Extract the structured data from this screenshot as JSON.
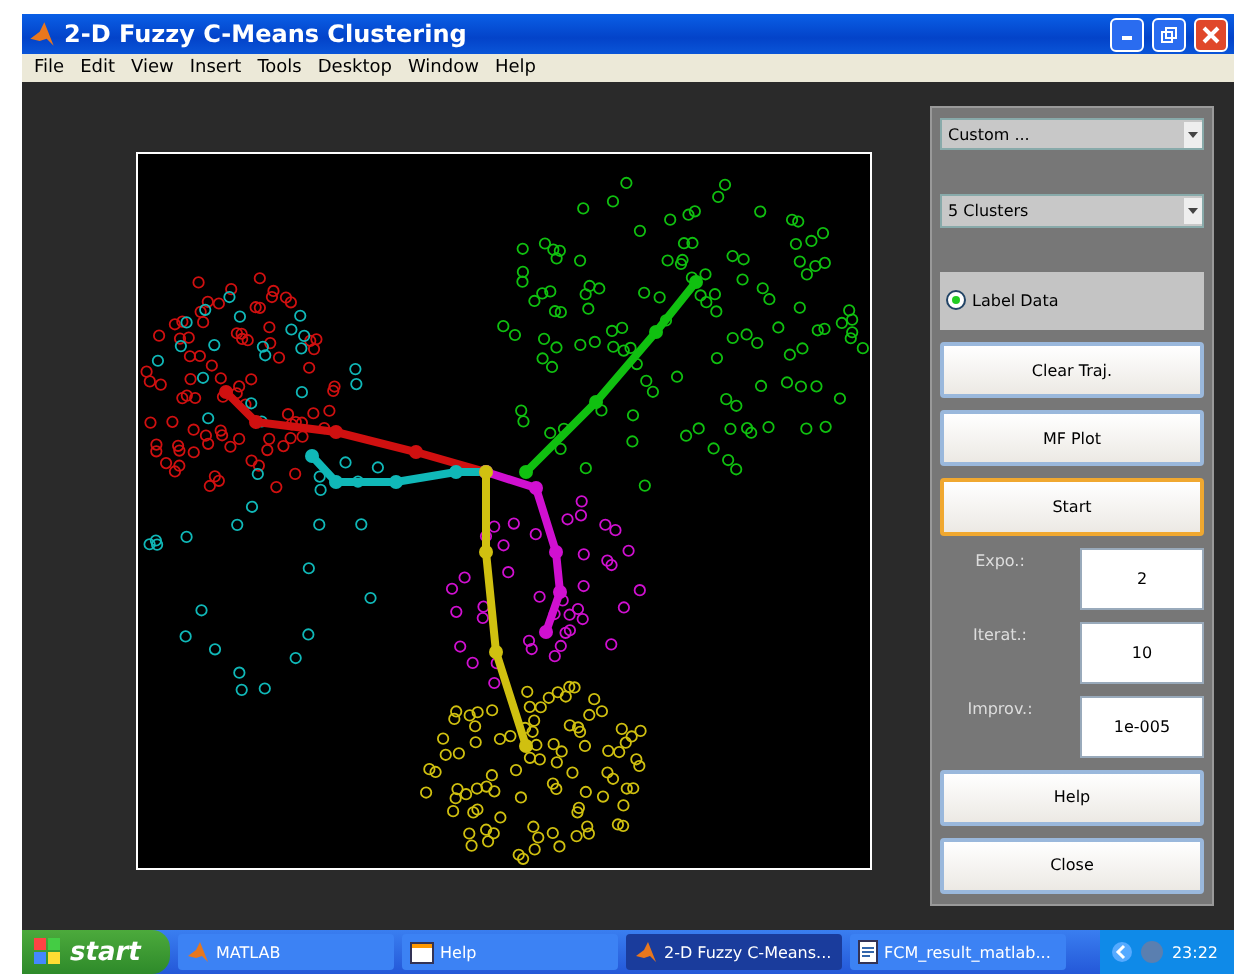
{
  "window": {
    "title": "2-D Fuzzy C-Means Clustering"
  },
  "menu": [
    "File",
    "Edit",
    "View",
    "Insert",
    "Tools",
    "Desktop",
    "Window",
    "Help"
  ],
  "panel": {
    "dropdowns": [
      {
        "value": "Custom ..."
      },
      {
        "value": "5 Clusters"
      }
    ],
    "radio": {
      "label": "Label Data",
      "checked": true
    },
    "buttons_top": [
      {
        "label": "Clear Traj.",
        "focused": false
      },
      {
        "label": "MF Plot",
        "focused": false
      },
      {
        "label": "Start",
        "focused": true
      }
    ],
    "params": [
      {
        "label": "Expo.:",
        "value": "2"
      },
      {
        "label": "Iterat.:",
        "value": "10"
      },
      {
        "label": "Improv.:",
        "value": "1e-005"
      }
    ],
    "buttons_bottom": [
      {
        "label": "Help",
        "focused": false
      },
      {
        "label": "Close",
        "focused": false
      }
    ]
  },
  "taskbar": {
    "start": "start",
    "items": [
      {
        "label": "MATLAB",
        "selected": false,
        "kind": "matlab"
      },
      {
        "label": "Help",
        "selected": false,
        "kind": "help"
      },
      {
        "label": "2-D Fuzzy C-Means...",
        "selected": true,
        "kind": "matlab"
      },
      {
        "label": "FCM_result_matlab...",
        "selected": false,
        "kind": "doc"
      }
    ],
    "clock": "23:22"
  }
}
